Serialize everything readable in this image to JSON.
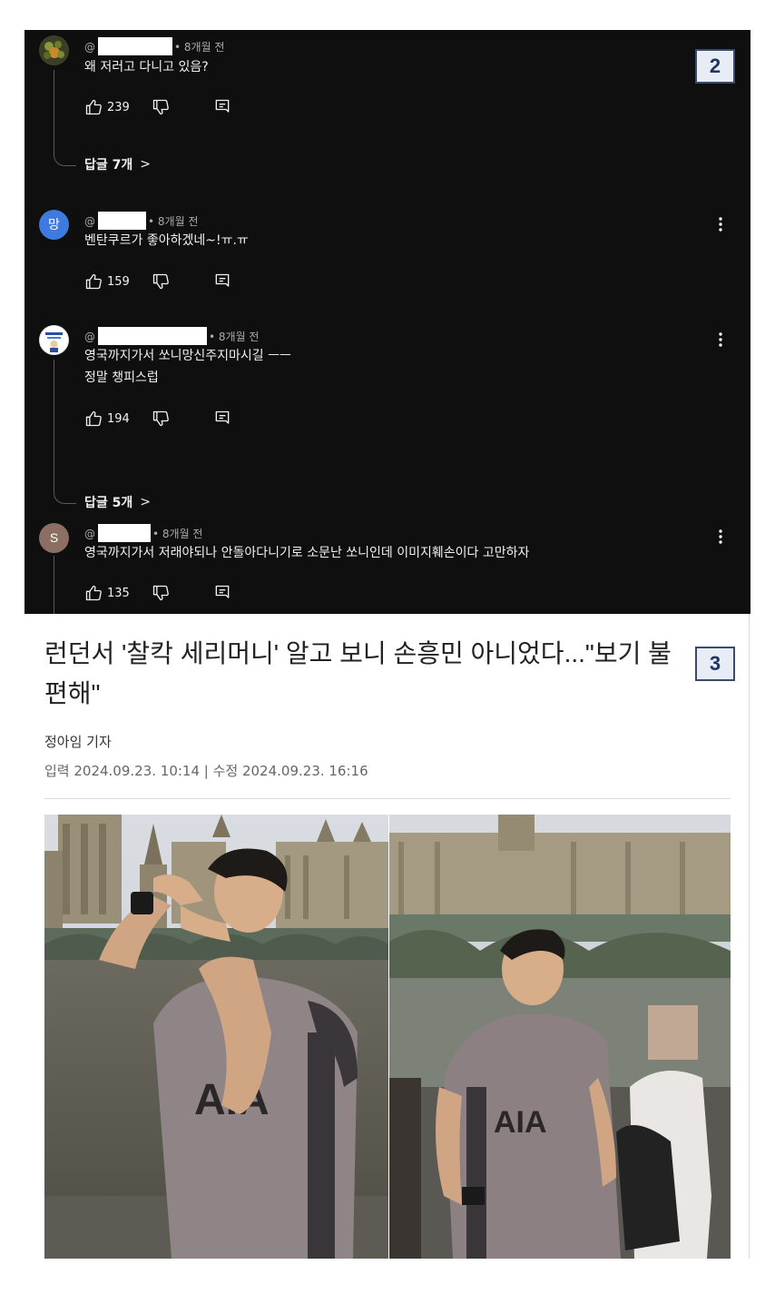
{
  "comments_panel": {
    "badge": "2",
    "comments": [
      {
        "avatar_text": "",
        "avatar_color": "#5b6b2a",
        "handle_prefix": "@",
        "time": "• 8개월 전",
        "lines": [
          "왜 저러고 다니고 있음?"
        ],
        "likes": "239",
        "replies_label": "답글 7개",
        "replies_chevron": ">"
      },
      {
        "avatar_text": "망",
        "avatar_color": "#3d7be0",
        "handle_prefix": "@",
        "time": "• 8개월 전",
        "lines": [
          "벤탄쿠르가 좋아하겠네~!ㅠ.ㅠ"
        ],
        "likes": "159"
      },
      {
        "avatar_text": "",
        "avatar_color": "#ffffff",
        "handle_prefix": "@",
        "time": "• 8개월 전",
        "lines": [
          "영국까지가서 쏘니망신주지마시길 ㅡㅡ",
          "정말 챙피스럽"
        ],
        "likes": "194",
        "replies_label": "답글 5개",
        "replies_chevron": ">"
      },
      {
        "avatar_text": "S",
        "avatar_color": "#8d6e63",
        "handle_prefix": "@",
        "time": "• 8개월 전",
        "lines": [
          "영국까지가서 저래야되나 안돌아다니기로 소문난 쏘니인데 이미지훼손이다 고만하자"
        ],
        "likes": "135"
      }
    ]
  },
  "article": {
    "badge": "3",
    "headline": "런던서 '찰칵 세리머니' 알고 보니 손흥민 아니었다...\"보기 불편해\"",
    "reporter": "정아임 기자",
    "dates": "입력 2024.09.23. 10:14 | 수정 2024.09.23. 16:16",
    "photo_left_alt": "Person making camera-frame gesture in front of Westminster",
    "photo_right_alt": "Person in Tottenham jersey walking by the Thames"
  },
  "colors": {
    "panel_bg": "#0f0f0f",
    "text_primary": "#f1f1f1",
    "text_secondary": "#aaaaaa",
    "badge_bg": "#e8ecf5",
    "badge_border": "#3a4a6b"
  },
  "icons": [
    "thumb-up-icon",
    "thumb-down-icon",
    "reply-icon",
    "more-vert-icon",
    "chevron-right-icon"
  ]
}
